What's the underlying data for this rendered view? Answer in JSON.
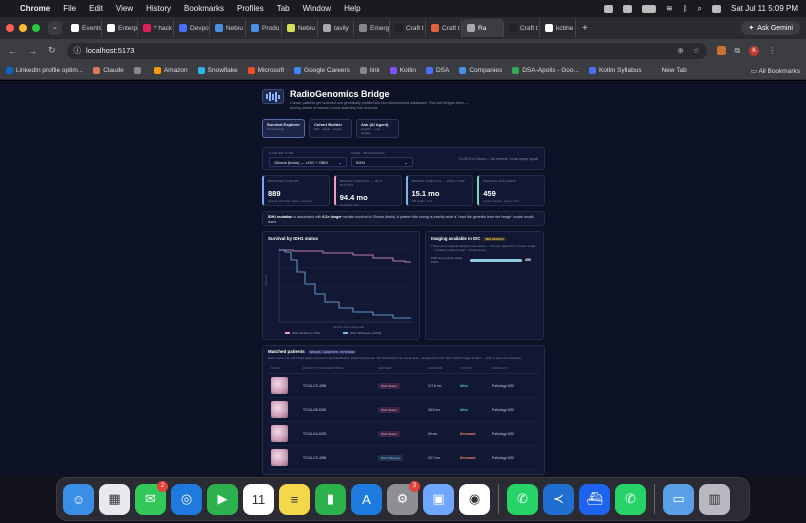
{
  "menubar": {
    "app": "Chrome",
    "items": [
      "File",
      "Edit",
      "View",
      "History",
      "Bookmarks",
      "Profiles",
      "Tab",
      "Window",
      "Help"
    ],
    "datetime": "Sat Jul 11  5:09 PM"
  },
  "tabs": [
    {
      "label": "Events",
      "color": "#ffffff"
    },
    {
      "label": "Enterp",
      "color": "#ffffff"
    },
    {
      "label": "* hack",
      "color": "#e01e5a"
    },
    {
      "label": "Devpo",
      "color": "#4a6cf7"
    },
    {
      "label": "Nebiu",
      "color": "#4a90e2"
    },
    {
      "label": "Produ",
      "color": "#4a90e2"
    },
    {
      "label": "Nebiu",
      "color": "#d4e157"
    },
    {
      "label": "tavily",
      "color": "#aaaaaa"
    },
    {
      "label": "Emerg",
      "color": "#888888"
    },
    {
      "label": "Craft t",
      "color": "#222222"
    },
    {
      "label": "Craft t",
      "color": "#e06040"
    },
    {
      "label": "Ra",
      "color": "#aaaaaa",
      "active": true
    },
    {
      "label": "Craft t",
      "color": "#222222"
    },
    {
      "label": "kcbhe",
      "color": "#ffffff"
    }
  ],
  "gemini_label": "Ask Gemini",
  "address": {
    "url": "localhost:5173",
    "avatar": "K"
  },
  "bookmarks": [
    {
      "label": "LinkedIn profile optim...",
      "color": "#0a66c2"
    },
    {
      "label": "Claude",
      "color": "#d97757"
    },
    {
      "label": "",
      "color": "#888888"
    },
    {
      "label": "Amazon",
      "color": "#ff9900"
    },
    {
      "label": "Snowflake",
      "color": "#29b5e8"
    },
    {
      "label": "Microsoft",
      "color": "#f25022"
    },
    {
      "label": "Google Careers",
      "color": "#4285f4"
    },
    {
      "label": "link",
      "color": "#888888"
    },
    {
      "label": "Kotlin",
      "color": "#7f52ff"
    },
    {
      "label": "DSA",
      "color": "#4a6cf7"
    },
    {
      "label": "Companies",
      "color": "#4a90e2"
    },
    {
      "label": "DSA-Apolis - Goo...",
      "color": "#34a853"
    },
    {
      "label": "Kotlin Syllabus",
      "color": "#4a6cf7"
    },
    {
      "label": "New Tab",
      "color": "#3c3d42"
    }
  ],
  "all_bookmarks": "All Bookmarks",
  "app": {
    "title": "RadioGenomics Bridge",
    "subtitle": "Cancer patients get scanned and genetically profiled into two disconnected databases. This tool bridges them — turning weeks of manual cohort assembly into seconds.",
    "modes": [
      {
        "title": "Survival Explorer",
        "sub": "live fan book",
        "active": true
      },
      {
        "title": "Cohort Builder",
        "sub": "filter · select · export",
        "active": false
      },
      {
        "title": "Ask (AI Agent)",
        "sub": "English → tool → answer",
        "active": false
      }
    ],
    "filters": {
      "cancer_label": "CANCER TYPE",
      "cancer_value": "Glioma (brain) — LGG + GBM",
      "gene_label": "GENE / BIOMARKER",
      "gene_value": "IDH1",
      "tip": "Try IDH1 in Glioma — the textbook 'virtual biopsy' signal"
    },
    "kpis": [
      {
        "label": "MATCHED COHORT",
        "value": "889",
        "sub": "patients with IDH1 status + survival",
        "color": "#7aa2ff"
      },
      {
        "label": "MEDIAN SURVIVAL — IDH1 MUTANT",
        "value": "94.4 mo",
        "sub": "91 deaths / 215",
        "color": "#f29ac9"
      },
      {
        "label": "MEDIAN SURVIVAL — WILD-TYPE",
        "value": "15.1 mo",
        "sub": "338 deaths / 674",
        "color": "#7ab8f0"
      },
      {
        "label": "IMAGING AVAILABLE",
        "value": "459",
        "sub": "cohort patients · pulse in IDC",
        "color": "#7ad8c8"
      }
    ],
    "callout": {
      "lead": "IDH1 mutation",
      "text1": " is associated with ",
      "ratio": "6.2× longer",
      "text2": " median survival in Glioma (brain). A pattern this strong is exactly what a \"read the genetics from the image\" model would learn."
    },
    "km": {
      "title": "Survival by IDH1 status",
      "xlabel": "Months since diagnosis",
      "ylabel": "Survival",
      "legend": [
        "IDH1 Mutant (n=215)",
        "IDH1 Wild-type (n=674)"
      ]
    },
    "imaging": {
      "title": "Imaging available in IDC",
      "badge": "SEE DETAILS",
      "desc": "These same patients already have scans — the raw material for a future image ↔ mutation model to learn \"virtual biopsy\".",
      "bar_label": "Pathology (whole-slide), 100%",
      "bar_value": "459",
      "bar_fraction": 1.0
    },
    "table": {
      "title": "Matched patients",
      "badge": "IMAGES · GENETICS · OUTCOME",
      "desc": "Each row is one real TCGA patient present in both databases, linked by barcode. The thumbnail is the actual scan, rendered live from IDC's public image archive — click to open full resolution.",
      "headers": [
        "SCAN",
        "PATIENT (TCGA BARCODE)",
        "MARKER",
        "SURVIVAL",
        "STATUS",
        "MODALITY"
      ],
      "rows": [
        {
          "id": "TCGA-CS-4938",
          "marker": "IDH1 Mutant",
          "mtype": "mut",
          "survival": "117.6 mo",
          "status": "Alive",
          "stype": "alive",
          "modality": "Pathology WSI"
        },
        {
          "id": "TCGA-DB-5280",
          "marker": "IDH1 Mutant",
          "mtype": "mut",
          "survival": "38.5 mo",
          "status": "Alive",
          "stype": "alive",
          "modality": "Pathology WSI"
        },
        {
          "id": "TCGA-DU-6392",
          "marker": "IDH1 Mutant",
          "mtype": "mut",
          "survival": "69 mo",
          "status": "Deceased",
          "stype": "dead",
          "modality": "Pathology WSI"
        },
        {
          "id": "TCGA-CS-4938",
          "marker": "IDH1 Wild-type",
          "mtype": "wt",
          "survival": "25.7 mo",
          "status": "Deceased",
          "stype": "dead",
          "modality": "Pathology WSI"
        }
      ]
    }
  },
  "dock": [
    {
      "name": "finder",
      "color": "#3a8ee6",
      "glyph": "☺"
    },
    {
      "name": "launchpad",
      "color": "#e8e8ee",
      "glyph": "▦"
    },
    {
      "name": "messages",
      "color": "#34c759",
      "glyph": "✉",
      "badge": "2"
    },
    {
      "name": "safari",
      "color": "#1f7ae0",
      "glyph": "◎"
    },
    {
      "name": "facetime",
      "color": "#2bb24c",
      "glyph": "▶"
    },
    {
      "name": "calendar",
      "color": "#ffffff",
      "glyph": "11"
    },
    {
      "name": "notes",
      "color": "#f5d84a",
      "glyph": "≡"
    },
    {
      "name": "numbers",
      "color": "#2bb24c",
      "glyph": "▮"
    },
    {
      "name": "app-store",
      "color": "#1f7ae0",
      "glyph": "A"
    },
    {
      "name": "system-settings",
      "color": "#8e8e93",
      "glyph": "⚙",
      "badge": "3"
    },
    {
      "name": "preview",
      "color": "#6fa6ff",
      "glyph": "▣"
    },
    {
      "name": "chrome",
      "color": "#ffffff",
      "glyph": "◉"
    },
    {
      "name": "whatsapp",
      "color": "#25d366",
      "glyph": "✆"
    },
    {
      "name": "vscode",
      "color": "#1f6fd0",
      "glyph": "≺"
    },
    {
      "name": "docker",
      "color": "#1d63ed",
      "glyph": "⛴"
    },
    {
      "name": "whatsapp-2",
      "color": "#25d366",
      "glyph": "✆"
    },
    {
      "name": "downloads",
      "color": "#5aa0e6",
      "glyph": "▭"
    },
    {
      "name": "trash",
      "color": "#b8b8c0",
      "glyph": "▥"
    }
  ]
}
